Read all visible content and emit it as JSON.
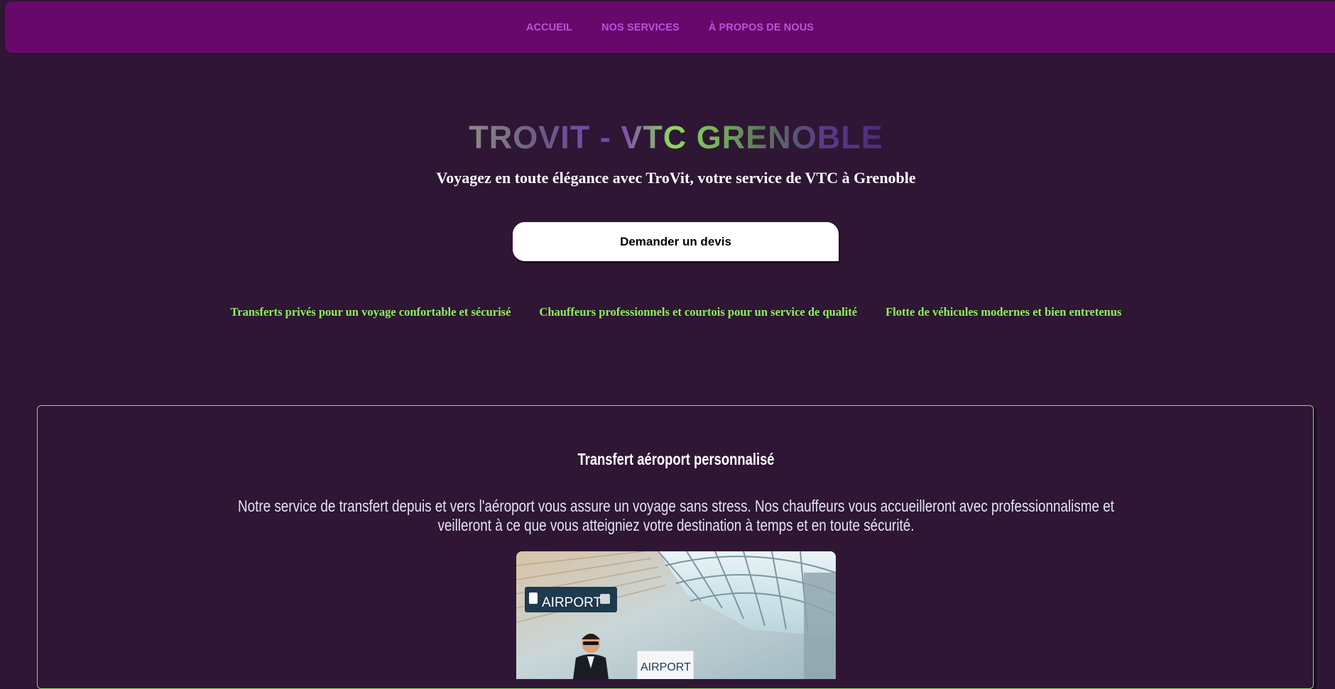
{
  "nav": {
    "items": [
      {
        "label": "ACCUEIL"
      },
      {
        "label": "NOS SERVICES"
      },
      {
        "label": "À PROPOS DE NOUS"
      }
    ]
  },
  "hero": {
    "title": "TROVIT - VTC GRENOBLE",
    "subtitle": "Voyagez en toute élégance avec TroVit, votre service de VTC à Grenoble",
    "cta_label": "Demander un devis"
  },
  "features": [
    {
      "text": "Transferts privés pour un voyage confortable et sécurisé"
    },
    {
      "text": "Chauffeurs professionnels et courtois pour un service de qualité"
    },
    {
      "text": "Flotte de véhicules modernes et bien entretenus"
    }
  ],
  "service": {
    "title": "Transfert aéroport personnalisé",
    "description": "Notre service de transfert depuis et vers l'aéroport vous assure un voyage sans stress. Nos chauffeurs vous accueilleront avec professionnalisme et veilleront à ce que vous atteigniez votre destination à temps et en toute sécurité.",
    "image": {
      "sign_text": "AIRPORT",
      "sign_text_2": "AIRPORT"
    }
  },
  "colors": {
    "background": "#2e1634",
    "navbar": "#69086b",
    "nav_link": "#b456dc",
    "feature_text": "#8df05a",
    "card_border": "#7fe05a"
  }
}
